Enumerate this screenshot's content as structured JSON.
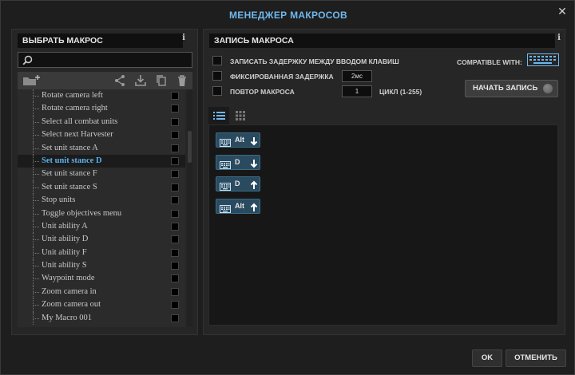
{
  "window": {
    "title": "МЕНЕДЖЕР МАКРОСОВ",
    "close_glyph": "✕"
  },
  "left": {
    "header": "ВЫБРАТЬ МАКРОС",
    "info": "i",
    "search_placeholder": "",
    "items": [
      {
        "label": "Rotate camera left"
      },
      {
        "label": "Rotate camera right"
      },
      {
        "label": "Select all combat units"
      },
      {
        "label": "Select next Harvester"
      },
      {
        "label": "Set unit stance A"
      },
      {
        "label": "Set unit stance D"
      },
      {
        "label": "Set unit stance F"
      },
      {
        "label": "Set unit stance S"
      },
      {
        "label": "Stop units"
      },
      {
        "label": "Toggle objectives menu"
      },
      {
        "label": "Unit ability A"
      },
      {
        "label": "Unit ability D"
      },
      {
        "label": "Unit ability F"
      },
      {
        "label": "Unit ability S"
      },
      {
        "label": "Waypoint mode"
      },
      {
        "label": "Zoom camera in"
      },
      {
        "label": "Zoom camera out"
      },
      {
        "label": "My Macro 001"
      }
    ],
    "selected_index": 5
  },
  "right": {
    "header": "ЗАПИСЬ МАКРОСА",
    "info": "i",
    "opt_delay": "ЗАПИСАТЬ ЗАДЕРЖКУ МЕЖДУ ВВОДОМ КЛАВИШ",
    "opt_fixed": "ФИКСИРОВАННАЯ ЗАДЕРЖКА",
    "fixed_value": "2мс",
    "opt_repeat": "ПОВТОР МАКРОСА",
    "repeat_value": "1",
    "repeat_suffix": "ЦИКЛ (1-255)",
    "compatible_label": "COMPATIBLE WITH:",
    "start_label": "НАЧАТЬ ЗАПИСЬ",
    "events": [
      {
        "key": "Alt",
        "direction": "down"
      },
      {
        "key": "D",
        "direction": "down"
      },
      {
        "key": "D",
        "direction": "up"
      },
      {
        "key": "Alt",
        "direction": "up"
      }
    ]
  },
  "footer": {
    "ok": "OK",
    "cancel": "ОТМЕНИТЬ"
  },
  "colors": {
    "accent": "#6fb8ee",
    "selected_text": "#5ab0ea",
    "event_bg": "#2a4a5f"
  },
  "icons": [
    "search-icon",
    "folder-add-icon",
    "share-icon",
    "download-icon",
    "copy-icon",
    "trash-icon",
    "list-view-icon",
    "grid-view-icon",
    "keyboard-icon",
    "arrow-down-icon",
    "arrow-up-icon",
    "record-icon"
  ]
}
